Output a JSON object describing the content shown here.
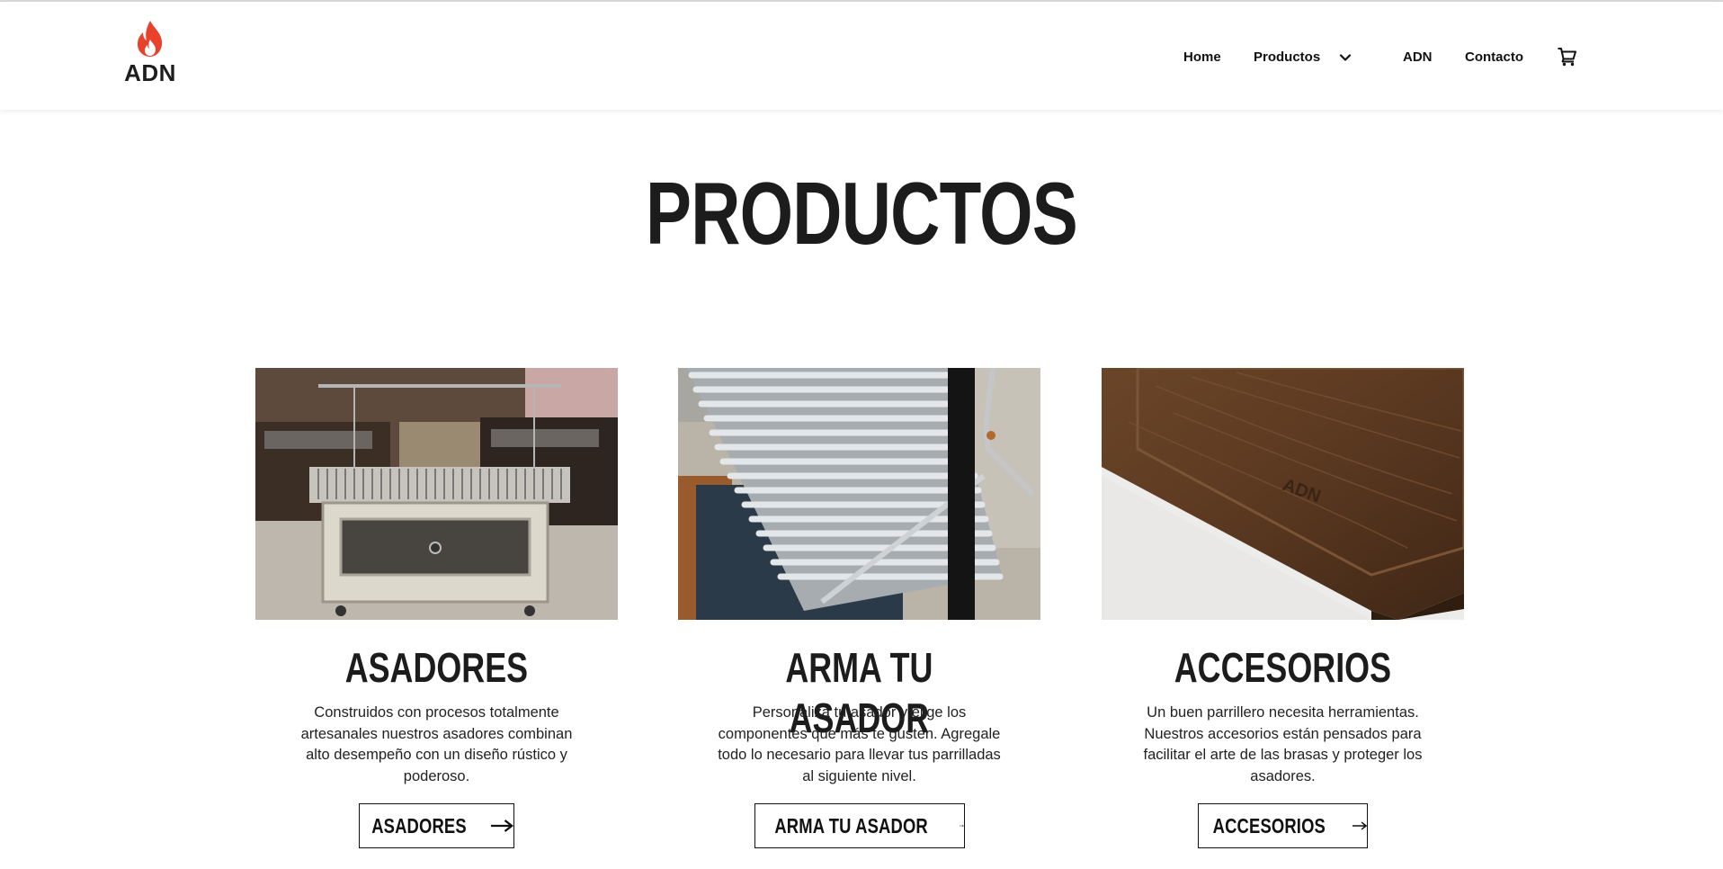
{
  "brand": {
    "logo_text": "ADN",
    "icon": "flame-icon",
    "flame_color": "#e8412c"
  },
  "nav": {
    "home": "Home",
    "products": "Productos",
    "products_icon": "chevron-down-icon",
    "adn": "ADN",
    "contact": "Contacto",
    "cart_icon": "shopping-cart-icon"
  },
  "main": {
    "title": "PRODUCTOS",
    "cards": [
      {
        "title": "ASADORES",
        "description": "Construidos con procesos totalmente artesanales nuestros asadores combinan alto desempeño con un diseño rústico y poderoso.",
        "button": "ASADORES",
        "button_icon": "arrow-right-icon"
      },
      {
        "title": "ARMA TU ASADOR",
        "description": "Personaliza tu asador y elige los componentes que más te gusten. Agregale todo lo necesario para llevar tus parrilladas al siguiente nivel.",
        "button": "ARMA TU ASADOR",
        "button_icon": "arrow-right-icon"
      },
      {
        "title": "ACCESORIOS",
        "description": "Un buen parrillero necesita herramientas. Nuestros accesorios están pensados para facilitar el arte de las brasas y proteger los asadores.",
        "button": "ACCESORIOS",
        "button_icon": "arrow-right-icon"
      }
    ]
  },
  "images": {
    "card_0_engraving": "ADN"
  }
}
